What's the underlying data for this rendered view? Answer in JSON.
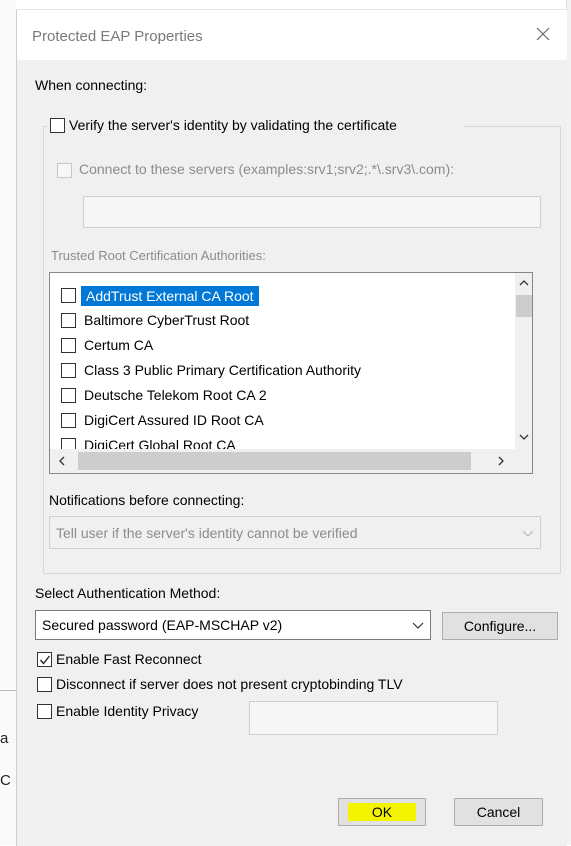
{
  "background": {
    "char_a": "a",
    "char_c": "C"
  },
  "dialog": {
    "title": "Protected EAP Properties",
    "when_connecting": "When connecting:",
    "verify_identity": {
      "label": "Verify the server's identity by validating the certificate",
      "checked": false
    },
    "connect_servers": {
      "label": "Connect to these servers (examples:srv1;srv2;.*\\.srv3\\.com):",
      "checked": false,
      "value": ""
    },
    "trusted_root_label": "Trusted Root Certification Authorities:",
    "trusted_roots": [
      {
        "label": "AddTrust External CA Root",
        "checked": false,
        "selected": true
      },
      {
        "label": "Baltimore CyberTrust Root",
        "checked": false,
        "selected": false
      },
      {
        "label": "Certum CA",
        "checked": false,
        "selected": false
      },
      {
        "label": "Class 3 Public Primary Certification Authority",
        "checked": false,
        "selected": false
      },
      {
        "label": "Deutsche Telekom Root CA 2",
        "checked": false,
        "selected": false
      },
      {
        "label": "DigiCert Assured ID Root CA",
        "checked": false,
        "selected": false
      },
      {
        "label": "DigiCert Global Root CA",
        "checked": false,
        "selected": false
      }
    ],
    "notifications_label": "Notifications before connecting:",
    "notifications_value": "Tell user if the server's identity cannot be verified",
    "auth_method_label": "Select Authentication Method:",
    "auth_method_value": "Secured password (EAP-MSCHAP v2)",
    "configure_button": "Configure...",
    "enable_fast_reconnect": {
      "label": "Enable Fast Reconnect",
      "checked": true
    },
    "disconnect_cryptobinding": {
      "label": "Disconnect if server does not present cryptobinding TLV",
      "checked": false
    },
    "enable_identity_privacy": {
      "label": "Enable Identity Privacy",
      "checked": false,
      "value": ""
    },
    "ok_button": "OK",
    "cancel_button": "Cancel",
    "colors": {
      "selection": "#0078d7",
      "ok_highlight": "#f4f400"
    }
  }
}
